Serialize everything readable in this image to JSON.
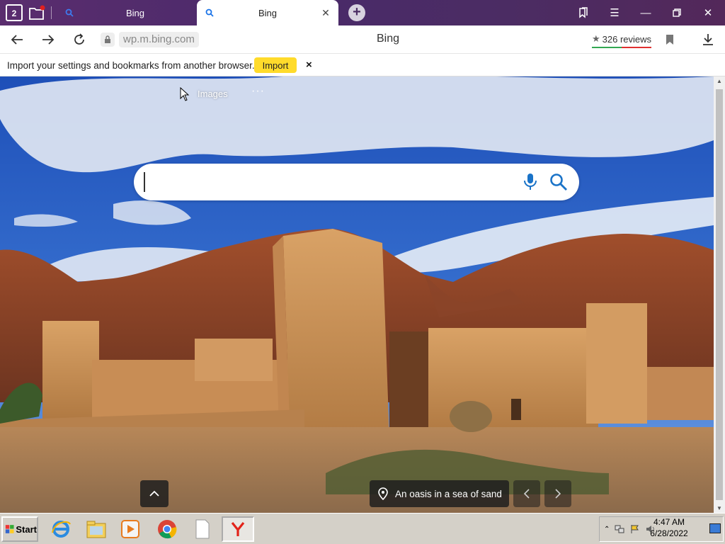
{
  "tabs": [
    {
      "title": "Bing",
      "active": false
    },
    {
      "title": "Bing",
      "active": true
    }
  ],
  "tab_counter": "2",
  "address": {
    "url": "wp.m.bing.com",
    "page_title": "Bing",
    "reviews_label": "326 reviews"
  },
  "import_banner": {
    "text": "Import your settings and bookmarks from another browser.",
    "button_label": "Import",
    "close_label": "×"
  },
  "page": {
    "images_link": "Images",
    "more_label": "···",
    "search_placeholder": "",
    "caption": "An oasis in a sea of sand"
  },
  "taskbar": {
    "start_label": "Start",
    "time": "4:47 AM",
    "date": "6/28/2022"
  },
  "colors": {
    "tab_strip": "#4b2c63",
    "import_button": "#ffdb2b",
    "sky": "#2f63c4",
    "sand": "#c98d4f"
  }
}
